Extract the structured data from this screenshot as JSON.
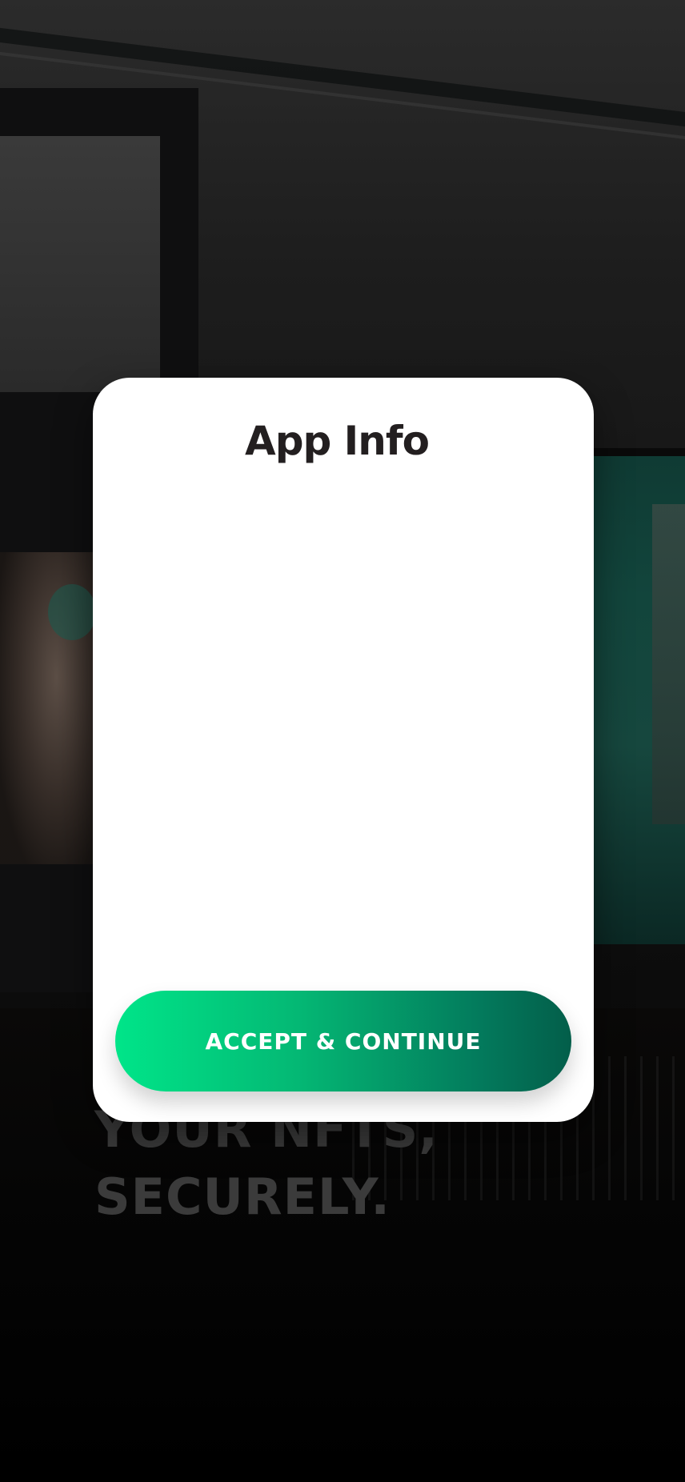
{
  "background": {
    "headline_lines": [
      "YOUR NFTS,",
      "SECURELY."
    ]
  },
  "modal": {
    "title": "App Info",
    "accept_button_label": "ACCEPT & CONTINUE"
  },
  "colors": {
    "accent_start": "#00e589",
    "accent_end": "#035e4a",
    "title_text": "#231f20"
  }
}
